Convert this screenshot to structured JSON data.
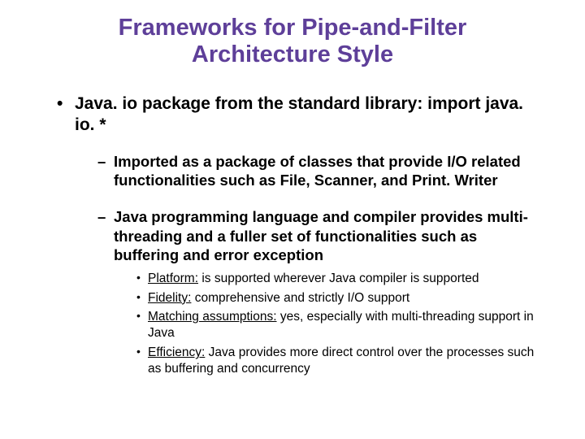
{
  "title": "Frameworks for Pipe-and-Filter Architecture Style",
  "b1": {
    "text_a": "Java. io package from the standard library: import ",
    "text_b": "java. io. *",
    "sub1": "Imported as a package of classes that provide I/O related functionalities such as File, Scanner, and Print. Writer",
    "sub2": "Java programming language and compiler provides multi-threading and a fuller set of functionalities such as buffering and error exception",
    "criteria": {
      "c1_label": "Platform:",
      "c1_text": " is supported wherever Java compiler  is supported",
      "c2_label": "Fidelity:",
      "c2_text": " comprehensive and strictly  I/O support",
      "c3_label": "Matching assumptions:",
      "c3_text": " yes, especially with multi-threading support in Java",
      "c4_label": "Efficiency:",
      "c4_text": " Java provides more direct control over the processes such as buffering and concurrency"
    }
  }
}
